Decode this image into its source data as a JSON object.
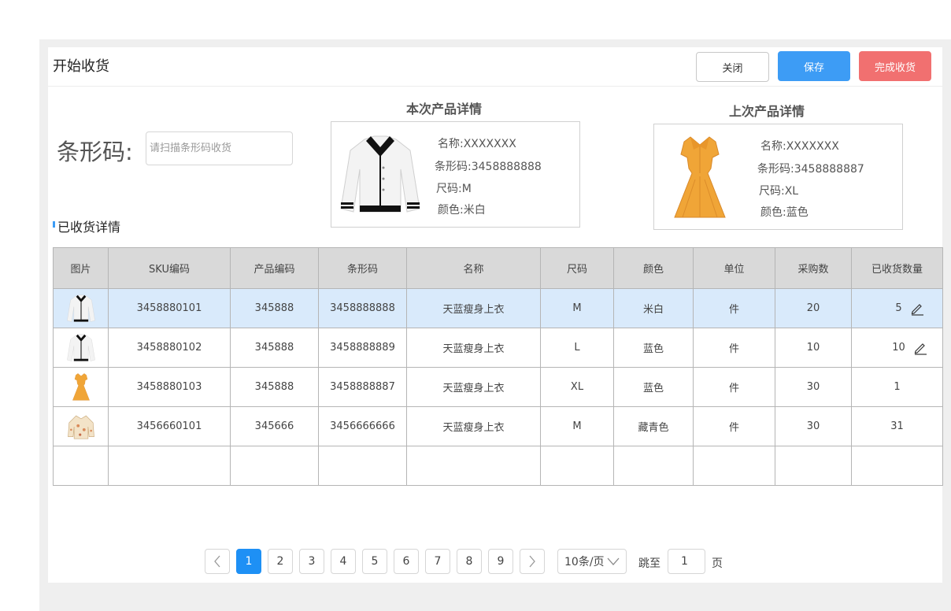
{
  "header": {
    "title": "开始收货",
    "close_label": "关闭",
    "save_label": "保存",
    "done_label": "完成收货",
    "save_color": "#3d9cf5",
    "done_color": "#f17070"
  },
  "scan": {
    "label": "条形码:",
    "placeholder": "请扫描条形码收货"
  },
  "current_product": {
    "title": "本次产品详情",
    "image_icon": "white-cardigan-image",
    "name": "名称:XXXXXXX",
    "barcode": "条形码:3458888888",
    "size": "尺码:M",
    "color": "颜色:米白"
  },
  "last_product": {
    "title": "上次产品详情",
    "image_icon": "yellow-dress-image",
    "name": "名称:XXXXXXX",
    "barcode": "条形码:3458888887",
    "size": "尺码:XL",
    "color": "颜色:蓝色"
  },
  "section_title": "已收货详情",
  "table": {
    "columns": [
      "图片",
      "SKU编码",
      "产品编码",
      "条形码",
      "名称",
      "尺码",
      "颜色",
      "单位",
      "采购数",
      "已收货数量"
    ],
    "rows": [
      {
        "image": "white-cardigan-image",
        "sku": "3458880101",
        "product_code": "345888",
        "barcode": "3458888888",
        "name": "天蓝瘦身上衣",
        "size": "M",
        "color": "米白",
        "unit": "件",
        "ordered": "20",
        "received": "5",
        "editable": true,
        "selected": true
      },
      {
        "image": "white-cardigan-image",
        "sku": "3458880102",
        "product_code": "345888",
        "barcode": "3458888889",
        "name": "天蓝瘦身上衣",
        "size": "L",
        "color": "蓝色",
        "unit": "件",
        "ordered": "10",
        "received": "10",
        "editable": true
      },
      {
        "image": "yellow-dress-image",
        "sku": "3458880103",
        "product_code": "345888",
        "barcode": "3458888887",
        "name": "天蓝瘦身上衣",
        "size": "XL",
        "color": "蓝色",
        "unit": "件",
        "ordered": "30",
        "received": "1",
        "editable": false
      },
      {
        "image": "floral-blouse-image",
        "sku": "3456660101",
        "product_code": "345666",
        "barcode": "3456666666",
        "name": "天蓝瘦身上衣",
        "size": "M",
        "color": "藏青色",
        "unit": "件",
        "ordered": "30",
        "received": "31",
        "editable": false,
        "received_color": "#e02020"
      }
    ]
  },
  "pagination": {
    "pages": [
      "1",
      "2",
      "3",
      "4",
      "5",
      "6",
      "7",
      "8",
      "9"
    ],
    "current_page": "1",
    "page_size": "10条/页",
    "jump_label": "跳至",
    "jump_value": "1",
    "page_suffix": "页",
    "active_color": "#1e90f5"
  }
}
